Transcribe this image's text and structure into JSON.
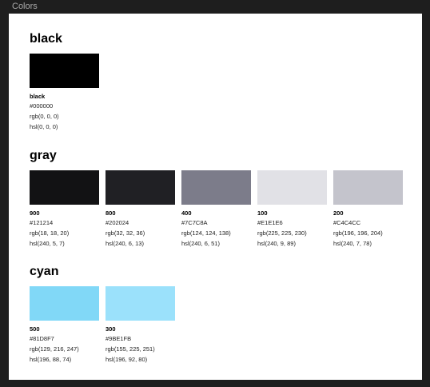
{
  "frame": {
    "label": "Colors"
  },
  "groups": [
    {
      "title": "black",
      "swatches": [
        {
          "name": "black",
          "hex": "#000000",
          "rgb": "rgb(0, 0, 0)",
          "hsl": "hsl(0, 0, 0)",
          "color": "#000000"
        }
      ]
    },
    {
      "title": "gray",
      "swatches": [
        {
          "name": "900",
          "hex": "#121214",
          "rgb": "rgb(18, 18, 20)",
          "hsl": "hsl(240, 5, 7)",
          "color": "#121214"
        },
        {
          "name": "800",
          "hex": "#202024",
          "rgb": "rgb(32, 32, 36)",
          "hsl": "hsl(240, 6, 13)",
          "color": "#202024"
        },
        {
          "name": "400",
          "hex": "#7C7C8A",
          "rgb": "rgb(124, 124, 138)",
          "hsl": "hsl(240, 6, 51)",
          "color": "#7C7C8A"
        },
        {
          "name": "100",
          "hex": "#E1E1E6",
          "rgb": "rgb(225, 225, 230)",
          "hsl": "hsl(240, 9, 89)",
          "color": "#E1E1E6"
        },
        {
          "name": "200",
          "hex": "#C4C4CC",
          "rgb": "rgb(196, 196, 204)",
          "hsl": "hsl(240, 7, 78)",
          "color": "#C4C4CC"
        }
      ]
    },
    {
      "title": "cyan",
      "swatches": [
        {
          "name": "500",
          "hex": "#81D8F7",
          "rgb": "rgb(129, 216, 247)",
          "hsl": "hsl(196, 88, 74)",
          "color": "#81D8F7"
        },
        {
          "name": "300",
          "hex": "#9BE1FB",
          "rgb": "rgb(155, 225, 251)",
          "hsl": "hsl(196, 92, 80)",
          "color": "#9BE1FB"
        }
      ]
    }
  ]
}
